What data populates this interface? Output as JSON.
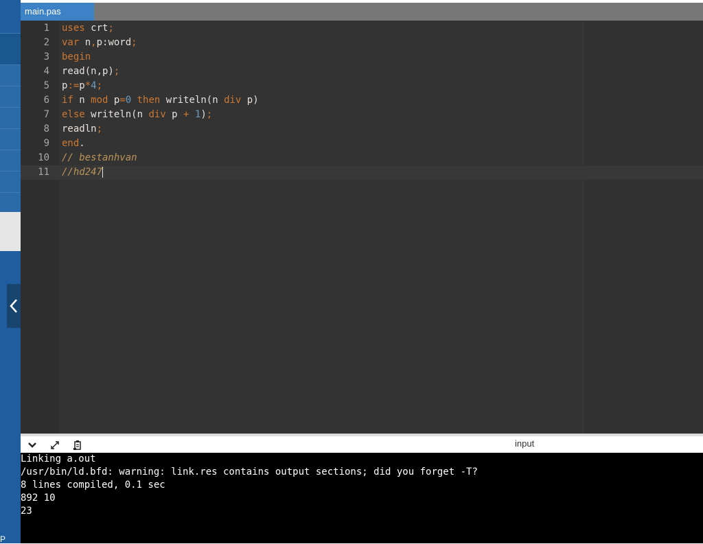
{
  "tab": {
    "filename": "main.pas"
  },
  "editor": {
    "lines": [
      {
        "num": "1",
        "tokens": [
          {
            "t": "kw",
            "v": "uses"
          },
          {
            "t": "id",
            "v": " crt"
          },
          {
            "t": "op",
            "v": ";"
          }
        ]
      },
      {
        "num": "2",
        "tokens": [
          {
            "t": "kw",
            "v": "var"
          },
          {
            "t": "id",
            "v": " n"
          },
          {
            "t": "op",
            "v": ","
          },
          {
            "t": "id",
            "v": "p:word"
          },
          {
            "t": "op",
            "v": ";"
          }
        ]
      },
      {
        "num": "3",
        "tokens": [
          {
            "t": "kw",
            "v": "begin"
          }
        ]
      },
      {
        "num": "4",
        "tokens": [
          {
            "t": "id",
            "v": "read(n,p)"
          },
          {
            "t": "op",
            "v": ";"
          }
        ]
      },
      {
        "num": "5",
        "tokens": [
          {
            "t": "id",
            "v": "p"
          },
          {
            "t": "op",
            "v": ":="
          },
          {
            "t": "id",
            "v": "p"
          },
          {
            "t": "op",
            "v": "*"
          },
          {
            "t": "num",
            "v": "4"
          },
          {
            "t": "op",
            "v": ";"
          }
        ]
      },
      {
        "num": "6",
        "tokens": [
          {
            "t": "kw",
            "v": "if"
          },
          {
            "t": "id",
            "v": " n "
          },
          {
            "t": "kw",
            "v": "mod"
          },
          {
            "t": "id",
            "v": " p"
          },
          {
            "t": "op",
            "v": "="
          },
          {
            "t": "num",
            "v": "0"
          },
          {
            "t": "id",
            "v": " "
          },
          {
            "t": "kw",
            "v": "then"
          },
          {
            "t": "id",
            "v": " writeln(n "
          },
          {
            "t": "kw",
            "v": "div"
          },
          {
            "t": "id",
            "v": " p)"
          }
        ]
      },
      {
        "num": "7",
        "tokens": [
          {
            "t": "kw",
            "v": "else"
          },
          {
            "t": "id",
            "v": " writeln(n "
          },
          {
            "t": "kw",
            "v": "div"
          },
          {
            "t": "id",
            "v": " p "
          },
          {
            "t": "op",
            "v": "+"
          },
          {
            "t": "id",
            "v": " "
          },
          {
            "t": "num",
            "v": "1"
          },
          {
            "t": "id",
            "v": ")"
          },
          {
            "t": "op",
            "v": ";"
          }
        ]
      },
      {
        "num": "8",
        "tokens": [
          {
            "t": "id",
            "v": "readln"
          },
          {
            "t": "op",
            "v": ";"
          }
        ]
      },
      {
        "num": "9",
        "tokens": [
          {
            "t": "kw",
            "v": "end"
          },
          {
            "t": "id",
            "v": "."
          }
        ]
      },
      {
        "num": "10",
        "tokens": [
          {
            "t": "cm",
            "v": "// bestanhvan"
          }
        ]
      },
      {
        "num": "11",
        "tokens": [
          {
            "t": "cm",
            "v": "//hd247"
          }
        ]
      }
    ]
  },
  "console_header": {
    "input_label": "input",
    "icons": [
      "chevron-down-icon",
      "expand-icon",
      "clear-console-icon"
    ]
  },
  "console": {
    "lines": [
      "Linking a.out",
      "/usr/bin/ld.bfd: warning: link.res contains output sections; did you forget -T?",
      "8 lines compiled, 0.1 sec",
      "892 10",
      "23"
    ]
  },
  "sidebar": {
    "partial_letter": "P"
  },
  "colors": {
    "sidebar": "#1f5d9e",
    "tab_active": "#3d82c6",
    "editor_bg": "#333333",
    "keyword": "#cc7833",
    "number": "#6d9cbe",
    "comment": "#bc9458",
    "console_bg": "#000000"
  }
}
